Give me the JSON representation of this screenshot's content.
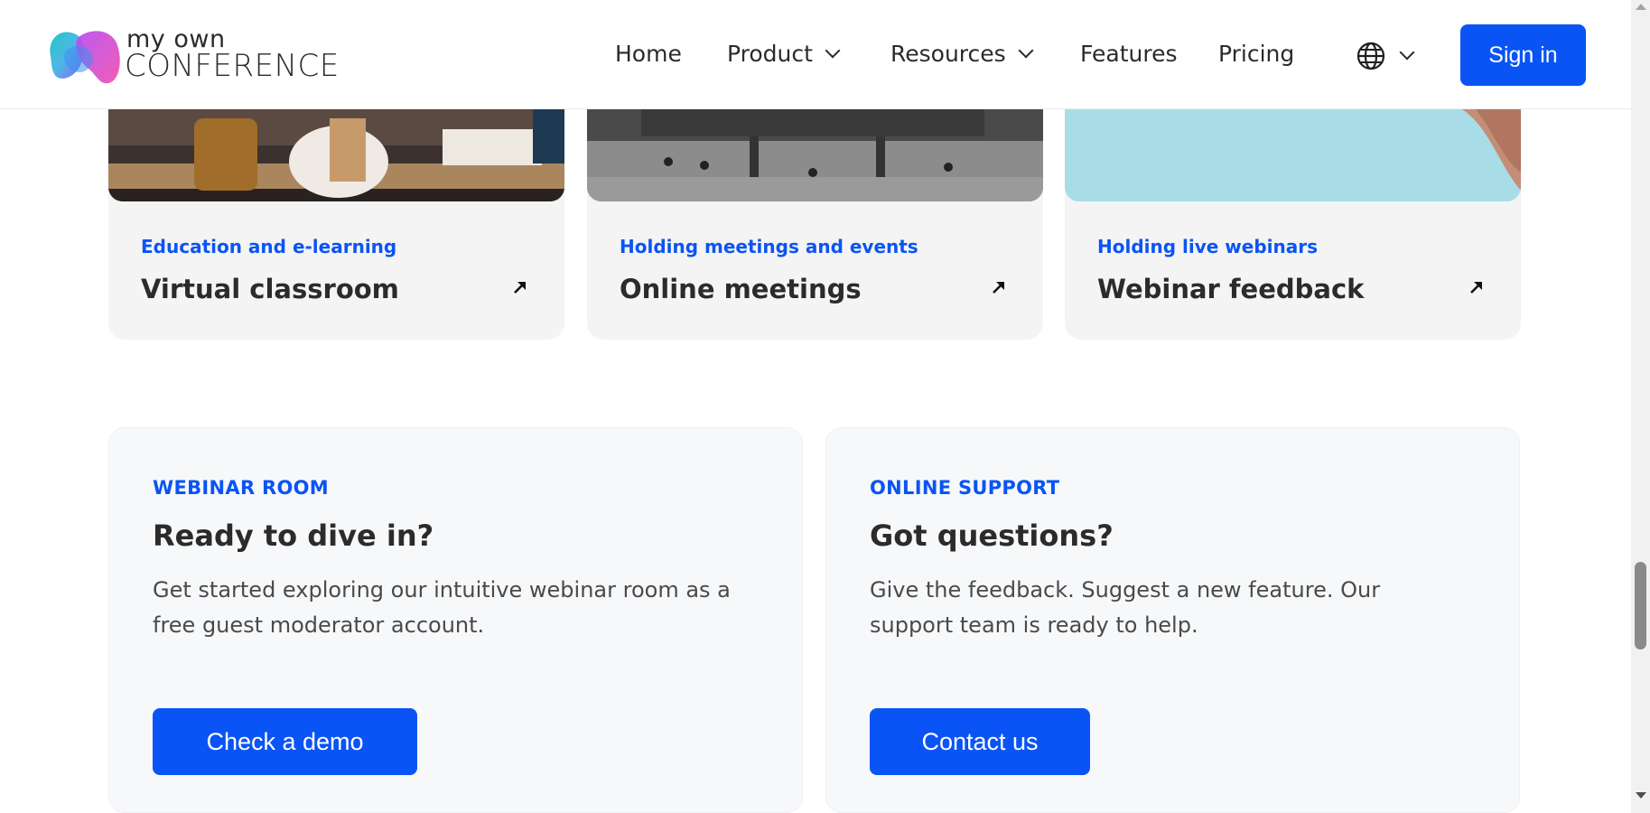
{
  "header": {
    "logo": {
      "line1": "my own",
      "line2": "CONFERENCE"
    },
    "nav": {
      "home": "Home",
      "product": "Product",
      "resources": "Resources",
      "features": "Features",
      "pricing": "Pricing"
    },
    "language_icon": "globe-icon",
    "sign_in": "Sign in"
  },
  "cards": [
    {
      "category": "Education and e-learning",
      "title": "Virtual classroom",
      "icon": "arrow-up-right-icon"
    },
    {
      "category": "Holding meetings and events",
      "title": "Online meetings",
      "icon": "arrow-up-right-icon"
    },
    {
      "category": "Holding live webinars",
      "title": "Webinar feedback",
      "icon": "arrow-up-right-icon"
    }
  ],
  "panels": [
    {
      "kicker": "WEBINAR ROOM",
      "title": "Ready to dive in?",
      "text": "Get started exploring our intuitive webinar room as a free guest moderator account.",
      "button": "Check a demo"
    },
    {
      "kicker": "ONLINE SUPPORT",
      "title": "Got questions?",
      "text": "Give the feedback. Suggest a new feature. Our support team is ready to help.",
      "button": "Contact us"
    }
  ],
  "colors": {
    "accent": "#0a54f5",
    "text": "#2b2b2b",
    "card_bg": "#f4f4f4",
    "panel_bg": "#f7f8fa"
  }
}
